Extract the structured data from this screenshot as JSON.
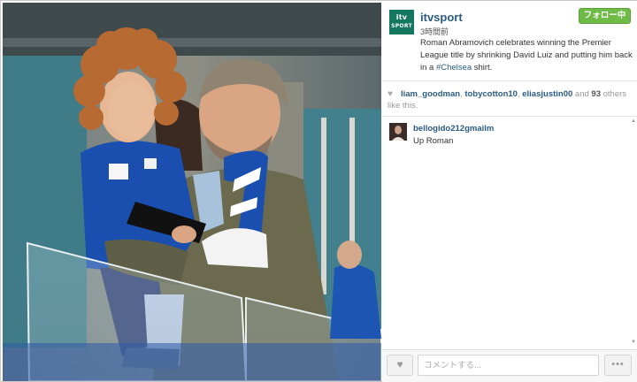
{
  "post": {
    "account": "itvsport",
    "avatar_line1": "itv",
    "avatar_line2": "SPORT",
    "time_ago": "3時間前",
    "follow_label": "フォロー中",
    "caption_text": "Roman Abramovich celebrates winning the Premier League title by shrinking David Luiz and putting him back in a ",
    "caption_hashtag": "#Chelsea",
    "caption_end": " shirt."
  },
  "likes": {
    "users": [
      "liam_goodman",
      "tobycotton10",
      "eliasjustin00"
    ],
    "sep": ", ",
    "and_text": " and ",
    "count": "93",
    "others_text": " others like this."
  },
  "comments": [
    {
      "user": "bellogido212gmailm",
      "text": "Up Roman"
    }
  ],
  "footer": {
    "comment_placeholder": "コメントする...",
    "more_label": "•••"
  },
  "icons": {
    "like": "heart-icon",
    "more": "more-dots-icon",
    "avatar": "itv-sport-logo"
  },
  "colors": {
    "brand_green": "#14775f",
    "follow_green": "#6fbb47",
    "link_blue": "#2a5b84",
    "chelsea_blue": "#1a4fb0"
  }
}
